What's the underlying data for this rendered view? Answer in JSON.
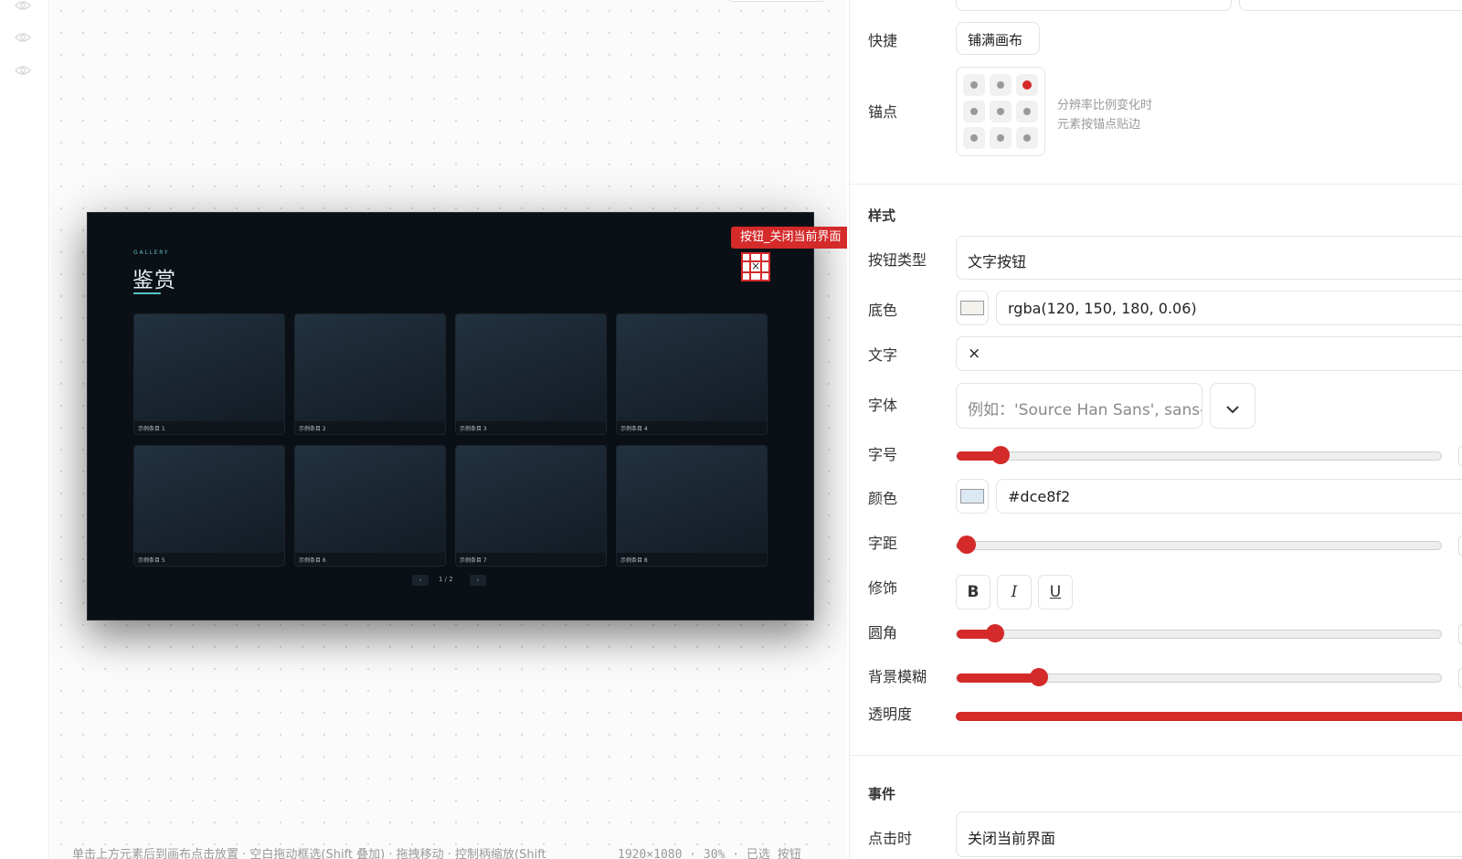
{
  "canvas": {
    "gallery_eyebrow": "GALLERY",
    "gallery_title": "鉴赏",
    "cards": [
      {
        "label": "示例条目 1"
      },
      {
        "label": "示例条目 2"
      },
      {
        "label": "示例条目 3"
      },
      {
        "label": "示例条目 4"
      },
      {
        "label": "示例条目 5"
      },
      {
        "label": "示例条目 6"
      },
      {
        "label": "示例条目 7"
      },
      {
        "label": "示例条目 8"
      }
    ],
    "pager": {
      "prev": "‹",
      "page_text": "1 / 2",
      "next": "›"
    },
    "selection_label": "按钮_关闭当前界面",
    "selected_button_text": "×",
    "status_text": "单击上方元素后到画布点击放置 · 空白拖动框选(Shift 叠加) · 拖拽移动 · 控制柄缩放(Shift",
    "status_meta": "1920×1080 · 30% · 已选 按钮"
  },
  "panel": {
    "shortcut": {
      "label": "快捷",
      "button": "铺满画布"
    },
    "anchor": {
      "label": "锚点",
      "hint_line1": "分辨率比例变化时",
      "hint_line2": "元素按锚点贴边",
      "selected": "top-right"
    },
    "style_section": "样式",
    "button_type": {
      "label": "按钮类型",
      "value": "文字按钮"
    },
    "bg_color": {
      "label": "底色",
      "value": "rgba(120, 150, 180, 0.06)",
      "swatch": "#f2f1ec"
    },
    "text": {
      "label": "文字",
      "value": "×"
    },
    "font": {
      "label": "字体",
      "placeholder": "例如：'Source Han Sans', sans-serif",
      "chevron": "⌄"
    },
    "font_size": {
      "label": "字号",
      "fraction": 0.09
    },
    "color": {
      "label": "颜色",
      "value": "#dce8f2",
      "swatch": "#dce8f2"
    },
    "letter_spacing": {
      "label": "字距",
      "fraction": 0.02
    },
    "decoration": {
      "label": "修饰",
      "bold": "B",
      "italic": "I",
      "underline": "U"
    },
    "radius": {
      "label": "圆角",
      "fraction": 0.08
    },
    "blur": {
      "label": "背景模糊",
      "fraction": 0.17
    },
    "opacity": {
      "label": "透明度",
      "fraction": 1.0
    },
    "event_section": "事件",
    "on_click": {
      "label": "点击时",
      "value": "关闭当前界面"
    }
  },
  "colors": {
    "accent": "#d42a2a",
    "gallery_accent": "#59c3c3",
    "screen_bg": "#0b1016"
  }
}
